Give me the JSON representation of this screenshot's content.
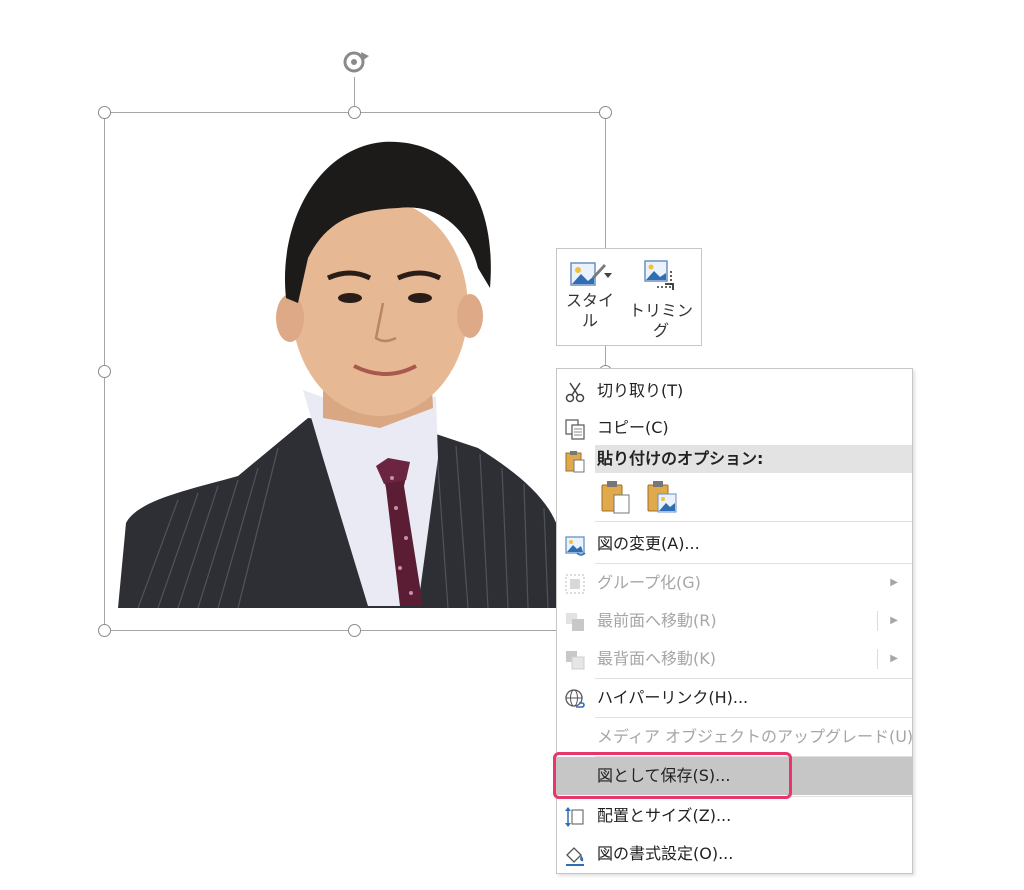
{
  "mini_toolbar": {
    "style_label_line1": "スタイ",
    "style_label_line2": "ル",
    "trim_label": "トリミング",
    "style_icon": "picture-style-icon",
    "trim_icon": "crop-icon"
  },
  "context_menu": {
    "cut": "切り取り(T)",
    "copy": "コピー(C)",
    "paste_options_header": "貼り付けのオプション:",
    "change_picture": "図の変更(A)...",
    "group": "グループ化(G)",
    "bring_to_front": "最前面へ移動(R)",
    "send_to_back": "最背面へ移動(K)",
    "hyperlink": "ハイパーリンク(H)...",
    "media_upgrade": "メディア オブジェクトのアップグレード(U)",
    "save_as_picture": "図として保存(S)...",
    "size_position": "配置とサイズ(Z)...",
    "format_picture": "図の書式設定(O)..."
  },
  "colors": {
    "highlight": "#e8356b",
    "hover_band": "#c6c6c6",
    "disabled_text": "#a6a6a6",
    "clipboard": "#e0a94a",
    "picture_icon_blue": "#2f6eb5"
  }
}
